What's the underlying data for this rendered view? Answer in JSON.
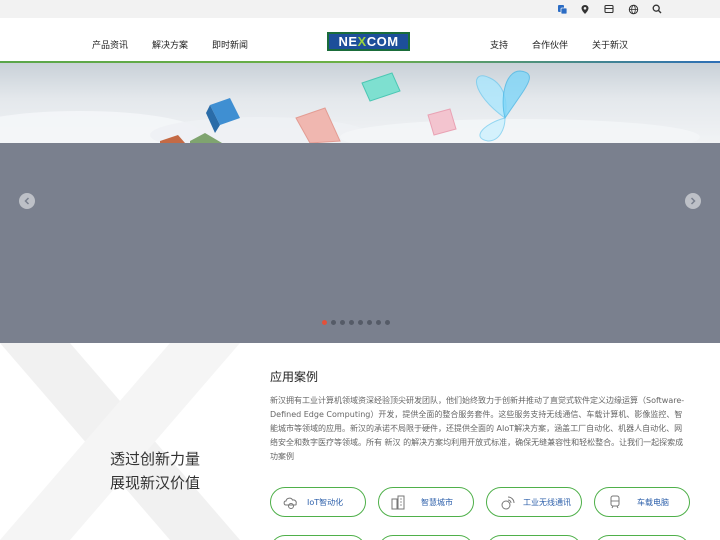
{
  "utility_bar": {
    "icons": [
      "language-icon",
      "location-pin-icon",
      "mail-icon",
      "globe-icon",
      "search-icon"
    ]
  },
  "nav": {
    "left_items": [
      "产品资讯",
      "解决方案",
      "即时新闻"
    ],
    "right_items": [
      "支持",
      "合作伙伴",
      "关于新汉"
    ],
    "logo": {
      "prefix": "NE",
      "x": "X",
      "suffix": "COM"
    }
  },
  "carousel": {
    "slide_count": 8,
    "active_index": 0,
    "colors": {
      "active_dot": "#e2503a",
      "slide_bg": "#7a808e"
    }
  },
  "slogan": {
    "line1": "透过创新力量",
    "line2": "展现新汉价值"
  },
  "applications": {
    "title": "应用案例",
    "description": "新汉拥有工业计算机领域资深经验顶尖研发团队，他们始终致力于创新并推动了直觉式软件定义边缘运算（Software-Defined Edge Computing）开发，提供全面的整合服务套件。这些服务支持无线通信、车载计算机、影像监控、智能城市等领域的应用。新汉的承诺不局限于硬件，还提供全面的 AIoT解决方案，涵盖工厂自动化、机器人自动化、网络安全和数字医疗等领域。所有 新汉 的解决方案均利用开放式标准，确保无缝兼容性和轻松整合。让我们一起探索成功案例",
    "cases": [
      {
        "label": "IoT智动化",
        "icon": "cloud-gear-icon"
      },
      {
        "label": "智慧城市",
        "icon": "city-buildings-icon"
      },
      {
        "label": "工业无线通讯",
        "icon": "5g-signal-icon"
      },
      {
        "label": "车载电脑",
        "icon": "train-icon"
      }
    ]
  },
  "colors": {
    "brand_green": "#4fb04a",
    "brand_blue": "#1d4f9a",
    "link_blue": "#2c5faa"
  }
}
